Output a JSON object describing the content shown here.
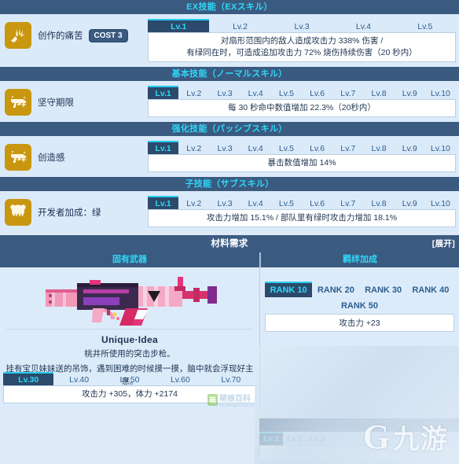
{
  "sections": {
    "ex": {
      "banner": "EX技能（EXスキル）",
      "icon": "impact-slash-icon",
      "name": "创作的痛苦",
      "cost": "COST 3",
      "tabs": [
        "Lv.1",
        "Lv.2",
        "Lv.3",
        "Lv.4",
        "Lv.5"
      ],
      "active_tab": 0,
      "desc_line1": "对扇形范围内的敌人造成攻击力 338% 伤害 /",
      "desc_line2": "有绿同在时，可造成追加攻击力 72% 烧伤持续伤害（20 秒内）"
    },
    "normal": {
      "banner": "基本技能（ノーマルスキル）",
      "icon": "pistol-icon",
      "name": "坚守期限",
      "tabs": [
        "Lv.1",
        "Lv.2",
        "Lv.3",
        "Lv.4",
        "Lv.5",
        "Lv.6",
        "Lv.7",
        "Lv.8",
        "Lv.9",
        "Lv.10"
      ],
      "active_tab": 0,
      "desc": "每 30 秒命中数值增加 22.3%（20秒内）"
    },
    "passive": {
      "banner": "强化技能（パッシブスキル）",
      "icon": "pistol-icon",
      "name": "创造感",
      "tabs": [
        "Lv.1",
        "Lv.2",
        "Lv.3",
        "Lv.4",
        "Lv.5",
        "Lv.6",
        "Lv.7",
        "Lv.8",
        "Lv.9",
        "Lv.10"
      ],
      "active_tab": 0,
      "desc": "暴击数值增加 14%"
    },
    "sub": {
      "banner": "子技能（サブスキル）",
      "icon": "bear-head-icon",
      "name": "开发者加成：绿",
      "tabs": [
        "Lv.1",
        "Lv.2",
        "Lv.3",
        "Lv.4",
        "Lv.5",
        "Lv.6",
        "Lv.7",
        "Lv.8",
        "Lv.9",
        "Lv.10"
      ],
      "active_tab": 0,
      "desc": "攻击力增加 15.1% / 部队里有绿时攻击力增加 18.1%"
    },
    "materials": {
      "banner": "材料需求",
      "expand": "[展开]"
    },
    "weapon": {
      "head": "固有武器",
      "art_icon": "pink-assault-rifle",
      "title": "Unique·Idea",
      "desc_line1": "桃井所使用的突击步枪。",
      "desc_line2": "挂有宝贝妹妹送的吊饰，遇到困难的时候摸一摸，脑中就会浮现好主意。",
      "tabs": [
        "Lv.30",
        "Lv.40",
        "Lv.50",
        "Lv.60",
        "Lv.70"
      ],
      "active_tab": 0,
      "desc": "攻击力 +305，体力 +2174"
    },
    "bond": {
      "head": "羁绊加成",
      "tabs_row1": [
        "RANK 10",
        "RANK 20",
        "RANK 30",
        "RANK 40"
      ],
      "tabs_row2": [
        "RANK 50"
      ],
      "active_tab": 0,
      "desc": "攻击力 +23"
    },
    "bottom_partial": {
      "tabs": [
        "Lv.1",
        "Lv.2",
        "Lv.3"
      ],
      "active_tab": 0
    }
  },
  "watermarks": {
    "moegirl_badge": "萌",
    "moegirl_text": "萌娘百科",
    "moegirl_url": "zh.moegirl.org.cn",
    "jiuyou_mark": "G",
    "jiuyou_text": "九游"
  },
  "colors": {
    "banner_bg": "#3a5a80",
    "banner_text": "#2fd8f8",
    "active_tab_bg": "#2c4a6b",
    "active_tab_text": "#2fd8f8",
    "accent_cyan": "#25cdf0",
    "icon_gold": "#c8970f",
    "page_bg": "#dcebfa"
  }
}
